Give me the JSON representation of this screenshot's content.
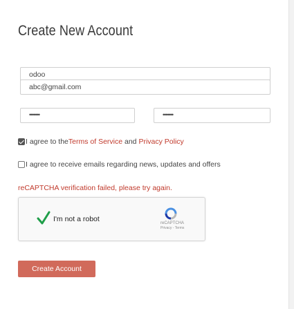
{
  "form": {
    "title": "Create New Account",
    "name_value": "odoo",
    "email_value": "abc@gmail.com",
    "password_value": "•••••••",
    "confirm_password_value": "•••••••"
  },
  "terms": {
    "checked": true,
    "prefix": "I agree to the ",
    "tos_link": "Terms of Service",
    "middle": " and ",
    "privacy_link": "Privacy Policy"
  },
  "newsletter": {
    "checked": false,
    "label": "I agree to receive emails regarding news, updates and offers"
  },
  "error_message": "reCAPTCHA verification failed, please try again.",
  "recaptcha": {
    "label": "I'm not a robot",
    "brand": "reCAPTCHA",
    "privacy": "Privacy",
    "separator": " - ",
    "terms": "Terms"
  },
  "submit_label": "Create Account",
  "colors": {
    "accent": "#d16a5b",
    "link": "#c0392b",
    "check_green": "#1f9e49"
  }
}
